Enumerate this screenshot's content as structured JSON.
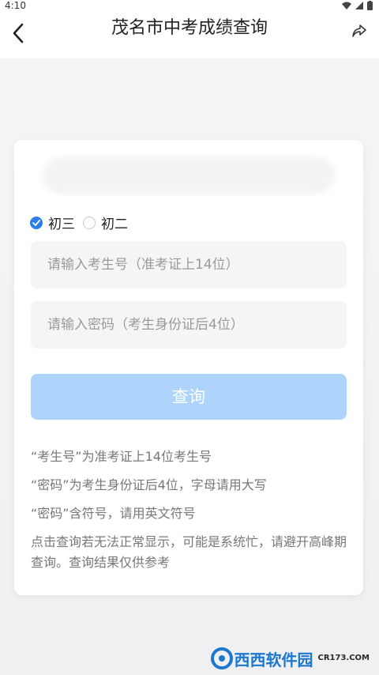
{
  "status_bar": {
    "time": "4:10"
  },
  "header": {
    "title": "茂名市中考成绩查询"
  },
  "form": {
    "grade_options": [
      {
        "label": "初三",
        "checked": true
      },
      {
        "label": "初二",
        "checked": false
      }
    ],
    "exam_number_placeholder": "请输入考生号（准考证上14位）",
    "password_placeholder": "请输入密码（考生身份证后4位）",
    "submit_label": "查询"
  },
  "notes": [
    "“考生号”为准考证上14位考生号",
    "“密码”为考生身份证后4位，字母请用大写",
    "“密码”含符号，请用英文符号",
    "点击查询若无法正常显示，可能是系统忙，请避开高峰期查询。查询结果仅供参考"
  ],
  "watermark": {
    "text": "西西软件园",
    "sub": "CR173.COM"
  },
  "colors": {
    "accent": "#2a7ee6",
    "button": "#aed4fb"
  }
}
